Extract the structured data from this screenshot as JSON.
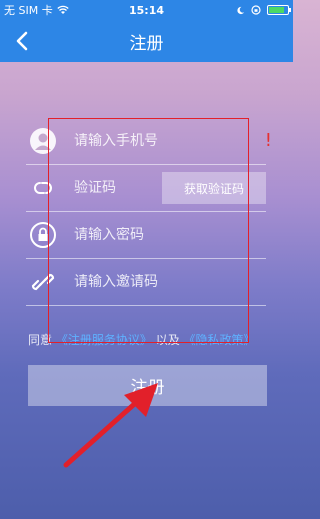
{
  "status_bar": {
    "carrier": "无 SIM 卡",
    "time": "15:14"
  },
  "nav": {
    "title": "注册"
  },
  "form": {
    "phone_placeholder": "请输入手机号",
    "code_placeholder": "验证码",
    "get_code_label": "获取验证码",
    "password_placeholder": "请输入密码",
    "invite_placeholder": "请输入邀请码",
    "error_mark": "!"
  },
  "agreement": {
    "prefix": "同意",
    "terms_link": "《注册服务协议》",
    "middle": "以及",
    "privacy_link": "《隐私政策》"
  },
  "submit_label": "注册",
  "colors": {
    "header": "#2d86e6",
    "link": "#5fb1ff",
    "annotation": "#e2202a"
  },
  "battery_level": 0.85
}
